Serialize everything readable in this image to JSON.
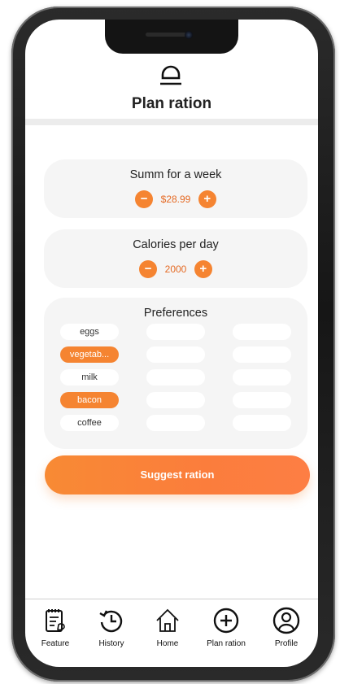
{
  "header": {
    "title": "Plan ration"
  },
  "budget": {
    "title": "Summ for a week",
    "value": "$28.99",
    "minus": "−",
    "plus": "+"
  },
  "calories": {
    "title": "Calories per day",
    "value": "2000",
    "minus": "−",
    "plus": "+"
  },
  "preferences": {
    "title": "Preferences",
    "items": [
      {
        "label": "eggs",
        "selected": false
      },
      {
        "label": "vegetab...",
        "selected": true
      },
      {
        "label": "milk",
        "selected": false
      },
      {
        "label": "bacon",
        "selected": true
      },
      {
        "label": "coffee",
        "selected": false
      }
    ]
  },
  "actions": {
    "suggest_label": "Suggest ration"
  },
  "nav": [
    {
      "label": "Feature",
      "icon": "notebook-icon"
    },
    {
      "label": "History",
      "icon": "history-icon"
    },
    {
      "label": "Home",
      "icon": "home-icon"
    },
    {
      "label": "Plan ration",
      "icon": "plus-circle-icon"
    },
    {
      "label": "Profile",
      "icon": "profile-icon"
    }
  ],
  "colors": {
    "accent": "#f58431",
    "card_bg": "#f5f5f5",
    "chip_bg": "#ffffff",
    "value_text": "#e56a24"
  }
}
